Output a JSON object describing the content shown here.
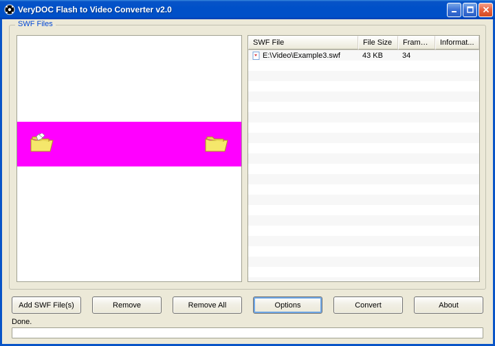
{
  "window": {
    "title": "VeryDOC Flash to Video Converter v2.0"
  },
  "group": {
    "label": "SWF Files"
  },
  "columns": {
    "swf": "SWF File",
    "size": "File Size",
    "frame": "Frame ...",
    "info": "Informat..."
  },
  "rows": [
    {
      "path": "E:\\Video\\Example3.swf",
      "size": "43 KB",
      "frame": "34",
      "info": ""
    }
  ],
  "buttons": {
    "add": "Add SWF File(s)",
    "remove": "Remove",
    "remove_all": "Remove All",
    "options": "Options",
    "convert": "Convert",
    "about": "About"
  },
  "status": {
    "text": "Done."
  }
}
